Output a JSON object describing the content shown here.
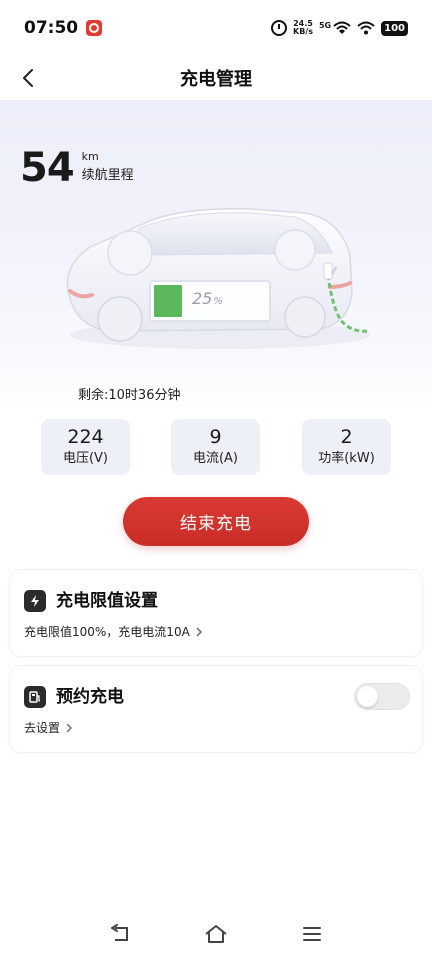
{
  "status_bar": {
    "time": "07:50",
    "net_speed_value": "24.5",
    "net_speed_unit": "KB/s",
    "network": "5G",
    "battery": "100"
  },
  "header": {
    "title": "充电管理"
  },
  "range": {
    "value": "54",
    "unit": "km",
    "label": "续航里程"
  },
  "charge": {
    "percent": "25",
    "percent_sign": "%",
    "level": 0.25,
    "remaining": "剩余:10时36分钟"
  },
  "metrics": [
    {
      "value": "224",
      "label": "电压(V)"
    },
    {
      "value": "9",
      "label": "电流(A)"
    },
    {
      "value": "2",
      "label": "功率(kW)"
    }
  ],
  "actions": {
    "end_charge_label": "结束充电"
  },
  "limit_card": {
    "title": "充电限值设置",
    "subtitle": "充电限值100%，充电电流10A",
    "icon": "lightning-icon"
  },
  "booking_card": {
    "title": "预约充电",
    "subtitle": "去设置",
    "icon": "charging-station-icon",
    "toggle_on": false
  },
  "colors": {
    "accent_red": "#d93a33",
    "battery_green": "#5cb85c",
    "metric_bg": "#eef0f7"
  }
}
